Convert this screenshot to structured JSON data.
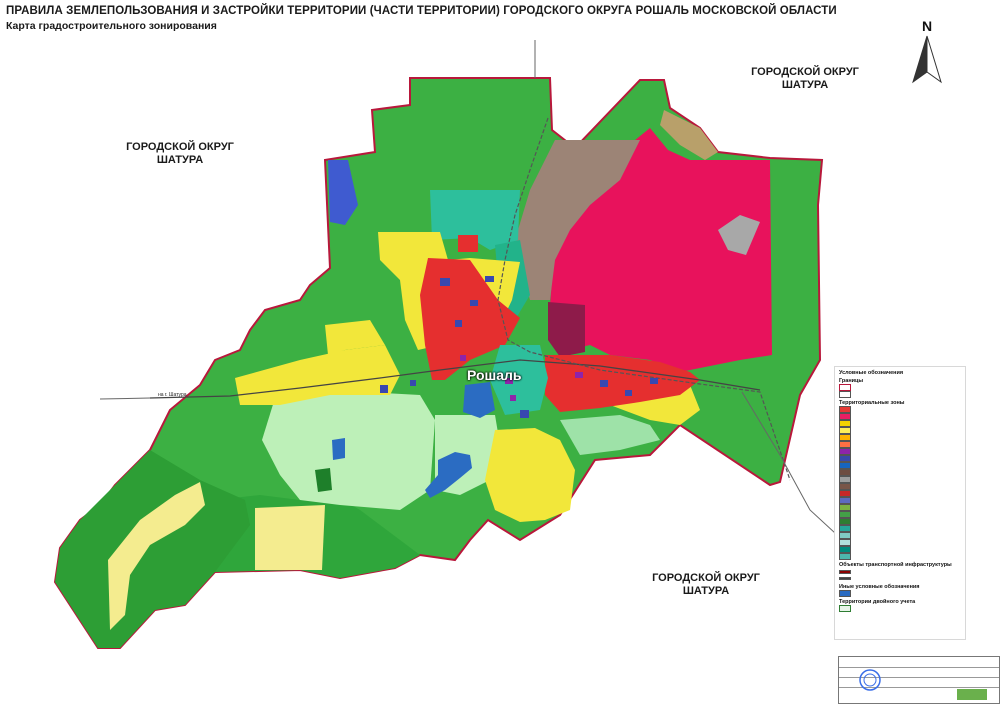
{
  "header": {
    "title": "ПРАВИЛА ЗЕМЛЕПОЛЬЗОВАНИЯ И ЗАСТРОЙКИ ТЕРРИТОРИИ (ЧАСТИ ТЕРРИТОРИИ) ГОРОДСКОГО ОКРУГА РОШАЛЬ МОСКОВСКОЙ ОБЛАСТИ",
    "subtitle": "Карта градостроительного зонирования"
  },
  "north_arrow": {
    "letter": "N"
  },
  "regions": {
    "west": {
      "line1": "ГОРОДСКОЙ ОКРУГ",
      "line2": "ШАТУРА"
    },
    "northeast": {
      "line1": "ГОРОДСКОЙ ОКРУГ",
      "line2": "ШАТУРА"
    },
    "southeast": {
      "line1": "ГОРОДСКОЙ ОКРУГ",
      "line2": "ШАТУРА"
    }
  },
  "city": {
    "name": "Рошаль"
  },
  "roads": {
    "west": "на г. Шатура"
  },
  "legend": {
    "title": "Условные обозначения",
    "section_borders": "Границы",
    "section_zones": "Территориальные зоны",
    "section_transport": "Объекты транспортной инфраструктуры",
    "section_other": "Иные условные обозначения",
    "section_territory": "Территории двойного учета",
    "zone_colors": [
      "#e53935",
      "#e91e63",
      "#f5d300",
      "#ffee58",
      "#ffb300",
      "#ff7043",
      "#8e24aa",
      "#3949ab",
      "#1565c0",
      "#6d4c41",
      "#9e9e9e",
      "#795548",
      "#c62828",
      "#5c6bc0",
      "#7cb342",
      "#43a047",
      "#2e7d32",
      "#26a69a",
      "#80cbc4",
      "#b2dfdb",
      "#00897b",
      "#4db6ac"
    ]
  },
  "colors": {
    "forest": "#3cb043",
    "forest_dark": "#1e9c2e",
    "residential": "#f2e73a",
    "light_yellow": "#f4ec8f",
    "industrial": "#e8125c",
    "business": "#e52f2f",
    "special": "#9c8476",
    "teal": "#2dbf9c",
    "light_green": "#bdf0b8",
    "water": "#2b6cc2",
    "military": "#8e1b4a",
    "boundary": "#b8183b"
  }
}
